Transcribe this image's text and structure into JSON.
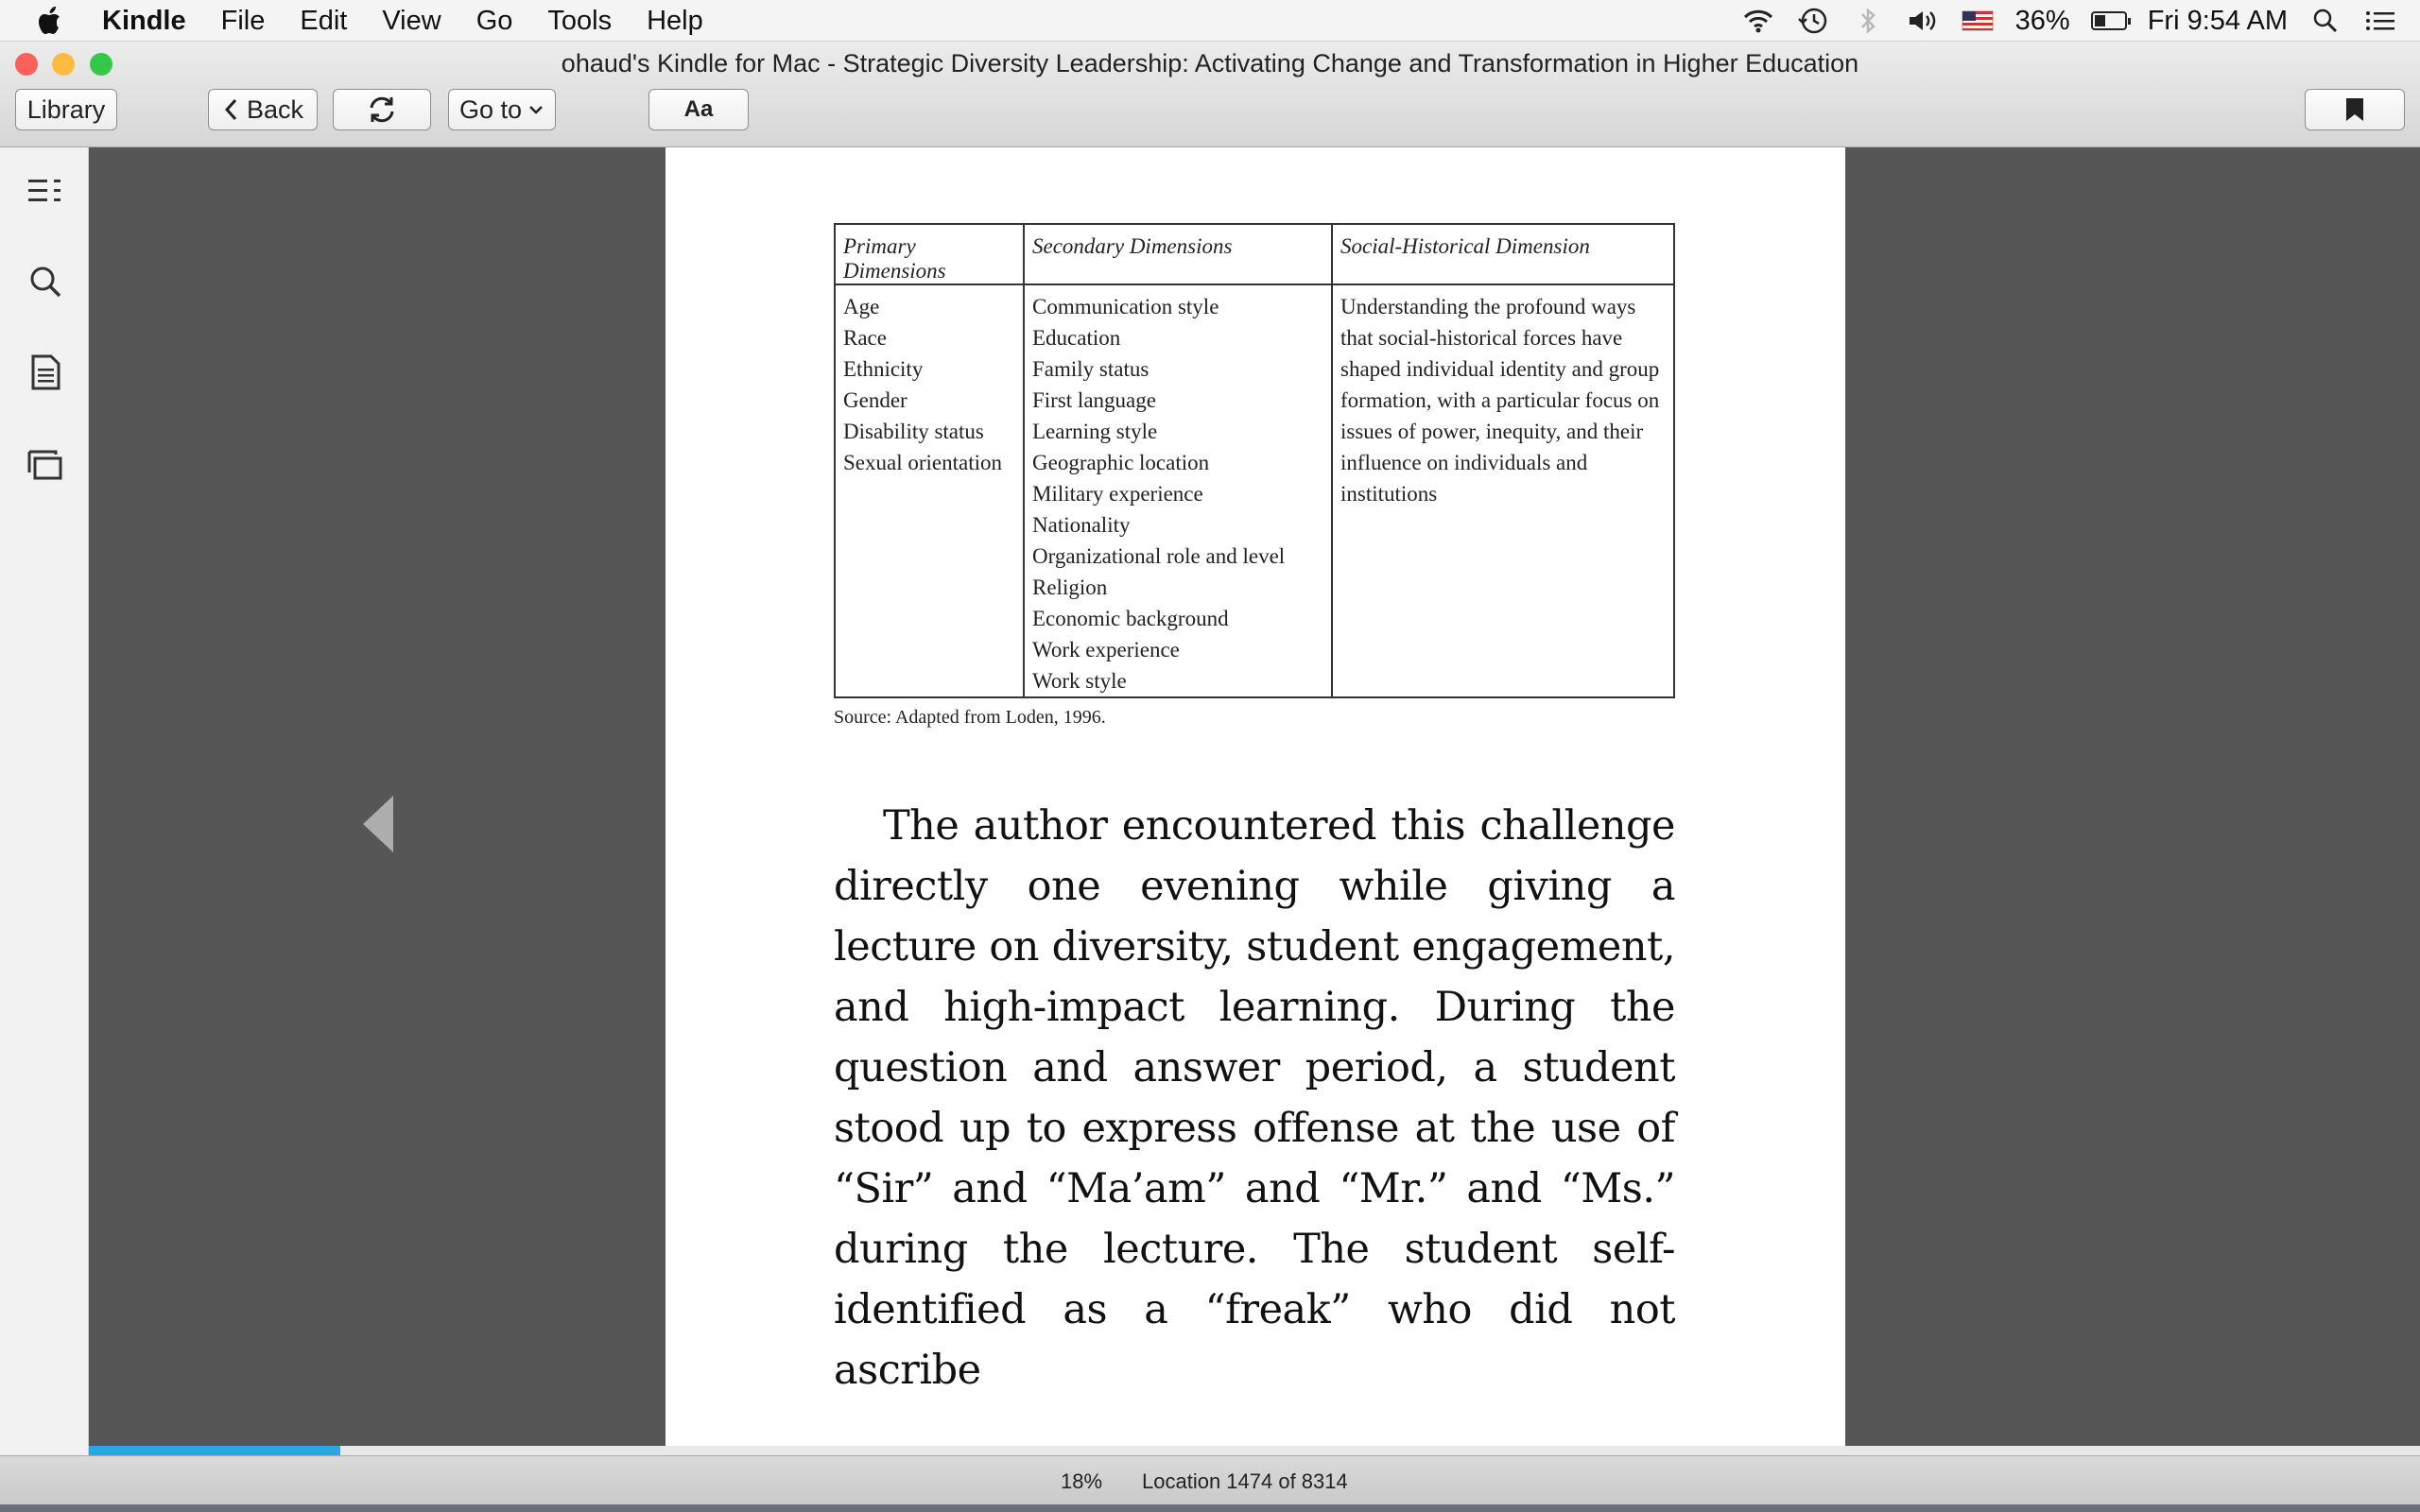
{
  "menubar": {
    "app_name": "Kindle",
    "menus": [
      "File",
      "Edit",
      "View",
      "Go",
      "Tools",
      "Help"
    ],
    "battery_percent": "36%",
    "battery_level": 0.36,
    "clock": "Fri 9:54 AM",
    "icons": [
      "apple-icon",
      "wifi-icon",
      "time-machine-icon",
      "bluetooth-icon",
      "volume-icon",
      "us-flag-icon",
      "battery-icon",
      "spotlight-icon",
      "notification-center-icon"
    ]
  },
  "window": {
    "title": "ohaud's Kindle for Mac - Strategic Diversity Leadership: Activating Change and Transformation in Higher Education",
    "traffic_colors": {
      "close": "#fc605b",
      "minimize": "#fdbc40",
      "zoom": "#34c84a"
    }
  },
  "toolbar": {
    "library_label": "Library",
    "back_label": "Back",
    "goto_label": "Go to",
    "font_label": "Aa"
  },
  "sidebar": {
    "icons": [
      "table-of-contents-icon",
      "search-icon",
      "notes-icon",
      "flashcards-icon"
    ]
  },
  "table": {
    "headers": [
      "Primary Dimensions",
      "Secondary Dimensions",
      "Social-Historical Dimension"
    ],
    "primary": [
      "Age",
      "Race",
      "Ethnicity",
      "Gender",
      "Disability status",
      "Sexual orientation"
    ],
    "secondary": [
      "Communication style",
      "Education",
      "Family status",
      "First language",
      "Learning style",
      "Geographic location",
      "Military experience",
      "Nationality",
      "Organizational role and level",
      "Religion",
      "Economic background",
      "Work experience",
      "Work style"
    ],
    "social_historical": "Understanding the profound ways that social-historical forces have shaped individual identity and group formation, with a particular focus on issues of power, inequity, and their influence on individuals and institutions",
    "source": "Source: Adapted from Loden, 1996."
  },
  "body_text": "The author encountered this challenge directly one evening while giving a lecture on diversity, student engagement, and high-impact learning. During the question and answer period, a student stood up to express offense at the use of “Sir” and “Ma’am” and “Mr.” and “Ms.” during the lecture. The student self-identified as a “freak” who did not ascribe",
  "status": {
    "percent_label": "18%",
    "progress": 0.18,
    "location": "Location 1474 of 8314"
  },
  "colors": {
    "progress": "#27a8e0"
  }
}
